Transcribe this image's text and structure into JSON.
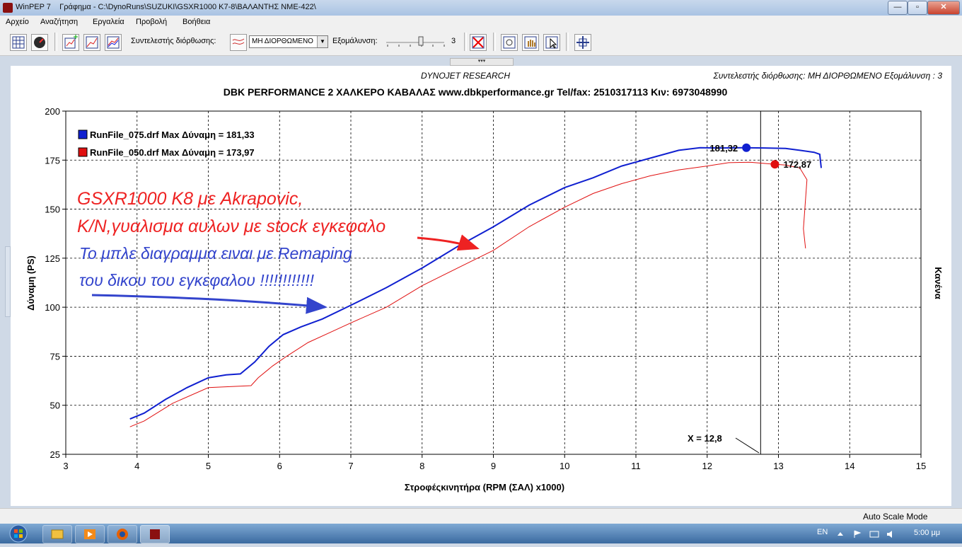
{
  "window": {
    "title": "WinPEP 7    Γράφημα - C:\\DynoRuns\\SUZUKI\\GSXR1000 K7-8\\ΒΑΛΑΝΤΗΣ ΝΜΕ-422\\",
    "minimize_symbol": "—",
    "maximize_symbol": "▫",
    "close_symbol": "✕"
  },
  "menu": {
    "items": [
      "Αρχείο",
      "Αναζήτηση",
      "Εργαλεία",
      "Προβολή",
      "Βοήθεια"
    ]
  },
  "toolbar": {
    "correction_label": "Συντελεστής διόρθωσης:",
    "correction_value": "ΜΗ ΔΙΟΡΘΩΜΕΝΟ",
    "smoothing_label": "Εξομάλυνση:",
    "smoothing_value": "3",
    "tab_handle_symbol": "▾▾▾"
  },
  "chart_header": {
    "brand": "DYNOJET RESEARCH",
    "right_info": "Συντελεστής διόρθωσης: ΜΗ ΔΙΟΡΘΩΜΕΝΟ     Εξομάλυνση : 3",
    "title": "DBK PERFORMANCE 2 ΧΑΛΚΕΡΟ ΚΑΒΑΛΑΣ www.dbkperformance.gr Tel/fax: 2510317113 Κιν: 6973048990",
    "right_axis_label": "Κανένα"
  },
  "annotations": {
    "red_line1": "GSXR1000 K8 με Akrapovic,",
    "red_line2": "K/N,γυαλισμα αυλων με stock εγκεφαλο",
    "blue_line1": "Το μπλε διαγραμμα ειναι με Remaping",
    "blue_line2": "του δικου του εγκεφαλου !!!!!!!!!!!!",
    "cursor_label": "X = 12,8"
  },
  "colors": {
    "blue_run": "#1020d0",
    "red_run": "#e01010",
    "annotation_red": "#ee2222",
    "annotation_blue": "#3344cc"
  },
  "chart_data": {
    "type": "line",
    "xlabel": "Στροφέςκινητήρα  (RPM (ΣΑΛ) x1000)",
    "ylabel": "Δύναμη   (PS)",
    "xlim": [
      3,
      15
    ],
    "ylim": [
      25,
      200
    ],
    "x_ticks": [
      3,
      4,
      5,
      6,
      7,
      8,
      9,
      10,
      11,
      12,
      13,
      14,
      15
    ],
    "y_ticks": [
      25,
      50,
      75,
      100,
      125,
      150,
      175,
      200
    ],
    "grid": true,
    "legend_position": "top-left",
    "cursor_x": 12.75,
    "series": [
      {
        "name": "RunFile_075.drf Max Δύναμη  = 181,33",
        "color": "#1020d0",
        "x": [
          3.9,
          4.1,
          4.4,
          4.7,
          5.0,
          5.25,
          5.45,
          5.65,
          5.85,
          6.05,
          6.3,
          6.6,
          7.0,
          7.5,
          8.0,
          8.5,
          9.0,
          9.5,
          10.0,
          10.4,
          10.8,
          11.2,
          11.6,
          11.9,
          12.2,
          12.5,
          12.8,
          13.1,
          13.3,
          13.5,
          13.58,
          13.6
        ],
        "y": [
          43,
          46,
          53,
          59,
          64,
          65.5,
          66,
          72,
          80,
          86,
          90,
          94,
          101,
          110,
          120,
          131,
          141,
          152,
          161,
          166,
          172,
          176,
          180,
          181.3,
          181.2,
          181.3,
          181.2,
          181,
          180,
          179,
          178,
          171
        ]
      },
      {
        "name": "RunFile_050.drf Max Δύναμη  = 173,97",
        "color": "#e01010",
        "x": [
          3.9,
          4.1,
          4.5,
          5.0,
          5.3,
          5.6,
          5.7,
          5.9,
          6.1,
          6.4,
          6.7,
          7.0,
          7.5,
          8.0,
          8.5,
          9.0,
          9.5,
          10.0,
          10.4,
          10.8,
          11.2,
          11.6,
          12.0,
          12.3,
          12.6,
          12.9,
          13.1,
          13.3,
          13.4,
          13.35,
          13.38
        ],
        "y": [
          39,
          42,
          51,
          59,
          59.5,
          60,
          64,
          70,
          75,
          82,
          87,
          92,
          100,
          111,
          120,
          129,
          141,
          151,
          158,
          163,
          167,
          170,
          172,
          173.7,
          173.9,
          173,
          172.5,
          171,
          165,
          140,
          130
        ]
      }
    ],
    "markers": [
      {
        "x": 12.55,
        "y": 181.32,
        "label": "181,32",
        "color": "#1020d0"
      },
      {
        "x": 12.95,
        "y": 172.87,
        "label": "172,87",
        "color": "#e01010"
      }
    ]
  },
  "statusbar": {
    "mode": "Auto Scale Mode"
  },
  "taskbar": {
    "lang": "EN",
    "clock": "5:00 μμ"
  }
}
